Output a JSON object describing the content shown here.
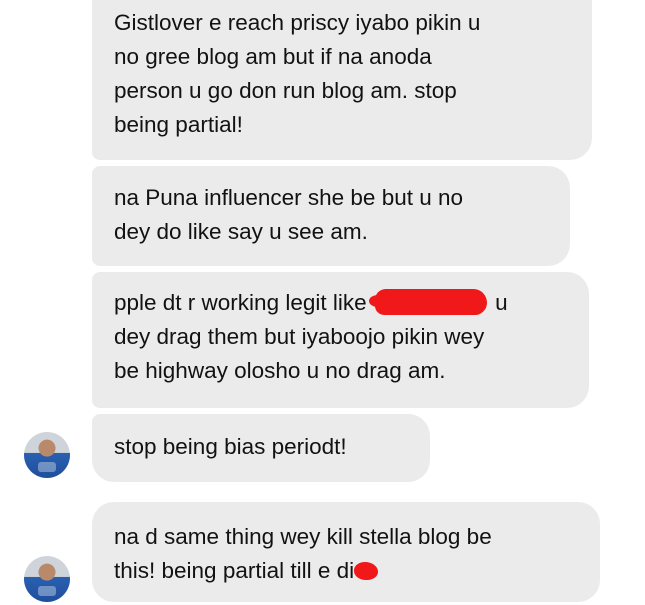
{
  "messages": [
    {
      "lines": [
        "Gistlover e reach priscy iyabo pikin u",
        "no gree blog am but if na anoda",
        "person u go don run blog am. stop",
        "being partial!"
      ]
    },
    {
      "lines": [
        "na Puna influencer she be but u no",
        "dey do like say u see am."
      ]
    },
    {
      "line1_start": "pple dt r working legit like",
      "line1_end": "u",
      "lines_rest": [
        "dey drag them but iyaboojo pikin wey",
        "be highway olosho u no drag am."
      ]
    },
    {
      "lines": [
        "stop being bias periodt!"
      ]
    },
    {
      "line1": "na d same thing wey kill stella blog be",
      "line2_start": "this! being partial till e di"
    }
  ],
  "colors": {
    "bubble": "#ebebeb",
    "text": "#121212",
    "redaction": "#f01818"
  },
  "avatar_icon": "user-avatar-photo"
}
